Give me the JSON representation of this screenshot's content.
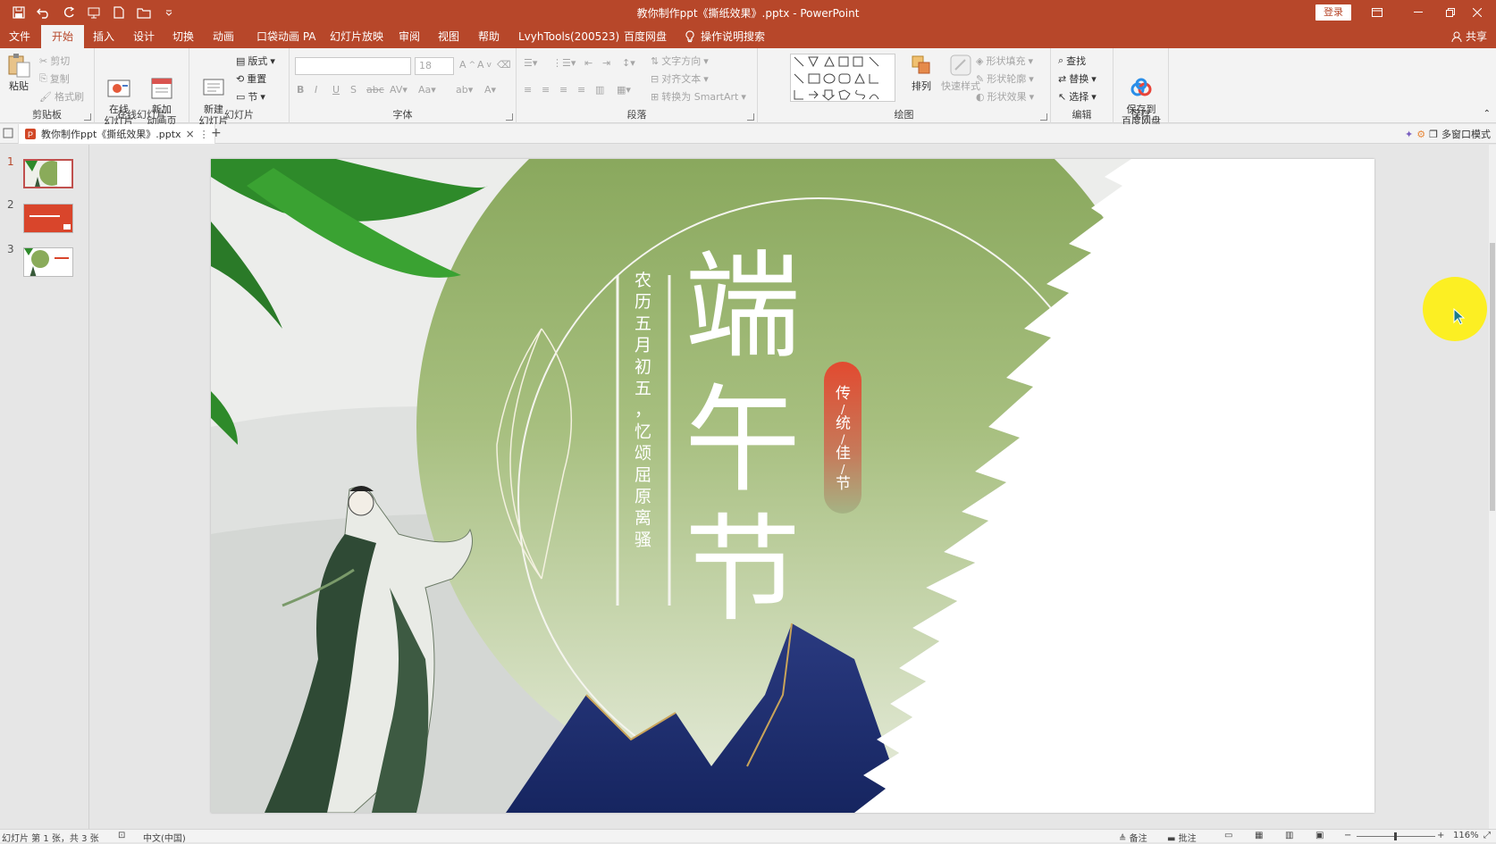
{
  "window": {
    "title": "教你制作ppt《撕纸效果》.pptx  -  PowerPoint",
    "login_label": "登录"
  },
  "ribbon_tabs": [
    {
      "label": "文件",
      "active": false
    },
    {
      "label": "开始",
      "active": true
    },
    {
      "label": "插入",
      "active": false
    },
    {
      "label": "设计",
      "active": false
    },
    {
      "label": "切换",
      "active": false
    },
    {
      "label": "动画",
      "active": false
    },
    {
      "label": "口袋动画 PA",
      "active": false
    },
    {
      "label": "幻灯片放映",
      "active": false
    },
    {
      "label": "审阅",
      "active": false
    },
    {
      "label": "视图",
      "active": false
    },
    {
      "label": "帮助",
      "active": false
    },
    {
      "label": "LvyhTools(200523)",
      "active": false
    },
    {
      "label": "百度网盘",
      "active": false
    }
  ],
  "tell_me": "操作说明搜索",
  "share_label": "共享",
  "ribbon": {
    "clipboard": {
      "paste": "粘贴",
      "cut": "剪切",
      "copy": "复制",
      "format_painter": "格式刷",
      "label": "剪贴板"
    },
    "online_slides": {
      "online": "在线\n幻灯片",
      "new_anim": "新加\n动画页",
      "label": "在线幻灯片"
    },
    "slides": {
      "new_slide": "新建\n幻灯片",
      "layout": "版式",
      "reset": "重置",
      "section": "节",
      "label": "幻灯片"
    },
    "font": {
      "font_name": "",
      "font_size": "18",
      "label": "字体"
    },
    "paragraph": {
      "text_direction": "文字方向",
      "align_text": "对齐文本",
      "smartart": "转换为 SmartArt",
      "label": "段落"
    },
    "drawing": {
      "arrange": "排列",
      "quick_styles": "快速样式",
      "shape_fill": "形状填充",
      "shape_outline": "形状轮廓",
      "shape_effects": "形状效果",
      "label": "绘图"
    },
    "editing": {
      "find": "查找",
      "replace": "替换",
      "select": "选择",
      "label": "编辑"
    },
    "save": {
      "save_to_baidu": "保存到\n百度网盘",
      "label": "保存"
    }
  },
  "doc_tab": {
    "name": "教你制作ppt《撕纸效果》.pptx"
  },
  "multi_window": "多窗口模式",
  "thumbnails": [
    {
      "number": "1",
      "selected": true
    },
    {
      "number": "2",
      "selected": false
    },
    {
      "number": "3",
      "selected": false
    }
  ],
  "slide": {
    "main_title": [
      "端",
      "午",
      "节"
    ],
    "subtitle": "农历五月初五，忆颂屈原离骚",
    "badge": "传/统/佳/节"
  },
  "statusbar": {
    "slide_info": "幻灯片 第 1 张，共 3 张",
    "language": "中文(中国)",
    "notes": "备注",
    "comments": "批注",
    "zoom": "116%"
  },
  "colors": {
    "accent": "#b7472a",
    "ribbon_bg": "#f3f3f3",
    "slide_green": "#8aab5a",
    "badge_red": "#e04a32",
    "mountain_blue": "#1e2f6e",
    "highlight": "#fff000"
  }
}
